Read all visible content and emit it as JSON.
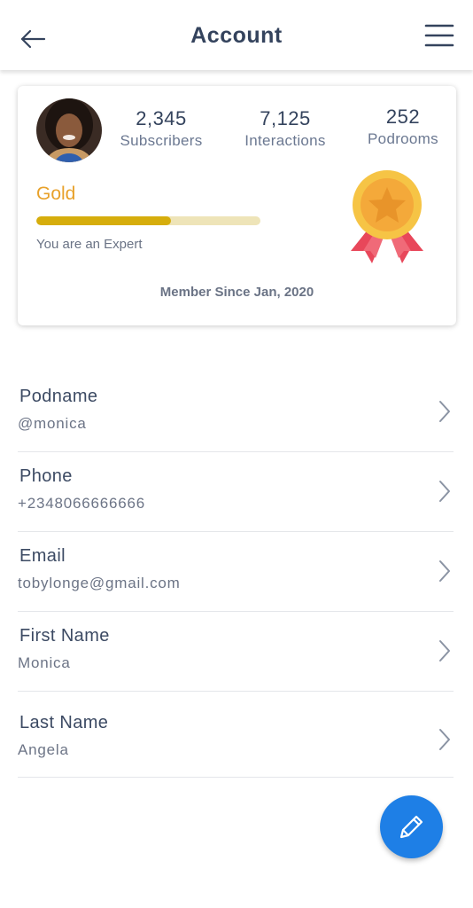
{
  "header": {
    "title": "Account",
    "back_icon": "arrow-left-icon",
    "menu_icon": "hamburger-menu-icon"
  },
  "profile": {
    "avatar": "user-avatar",
    "stats": [
      {
        "value": "2,345",
        "label": "Subscribers"
      },
      {
        "value": "7,125",
        "label": "Interactions"
      },
      {
        "value": "252",
        "label": "Podrooms"
      }
    ],
    "tier": "Gold",
    "tier_progress": 0.6,
    "level_text": "You are an Expert",
    "member_since": "Member Since Jan, 2020",
    "medal_icon": "gold-medal-icon"
  },
  "fields": [
    {
      "label": "Podname",
      "value": "@monica"
    },
    {
      "label": "Phone",
      "value": "+2348066666666"
    },
    {
      "label": "Email",
      "value": "tobylonge@gmail.com"
    },
    {
      "label": "First Name",
      "value": "Monica"
    },
    {
      "label": "Last Name",
      "value": "Angela"
    }
  ],
  "fab_icon": "pencil-edit-icon",
  "colors": {
    "accent": "#1e7fe6",
    "gold_text": "#e8a12a",
    "gold_bar": "#d6ad0c",
    "heading": "#34435d"
  }
}
